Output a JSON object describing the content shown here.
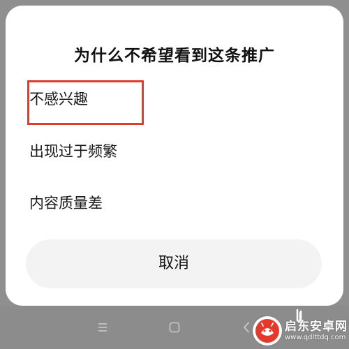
{
  "dialog": {
    "title": "为什么不希望看到这条推广",
    "options": [
      {
        "label": "不感兴趣",
        "highlighted": true
      },
      {
        "label": "出现过于频繁",
        "highlighted": false
      },
      {
        "label": "内容质量差",
        "highlighted": false
      }
    ],
    "cancel_label": "取消"
  },
  "navbar": {
    "icons": [
      "menu-icon",
      "home-icon",
      "back-icon"
    ]
  },
  "watermark": {
    "name": "启东安卓网",
    "url": "www.qdlttdq.com"
  },
  "colors": {
    "highlight_border": "#e4392d",
    "sheet_background": "#ffffff",
    "cancel_background": "#f3f3f3",
    "navbar_background": "#8c8c8c",
    "dim_overlay": "#8f8f8f",
    "watermark_red": "#e4392d"
  }
}
